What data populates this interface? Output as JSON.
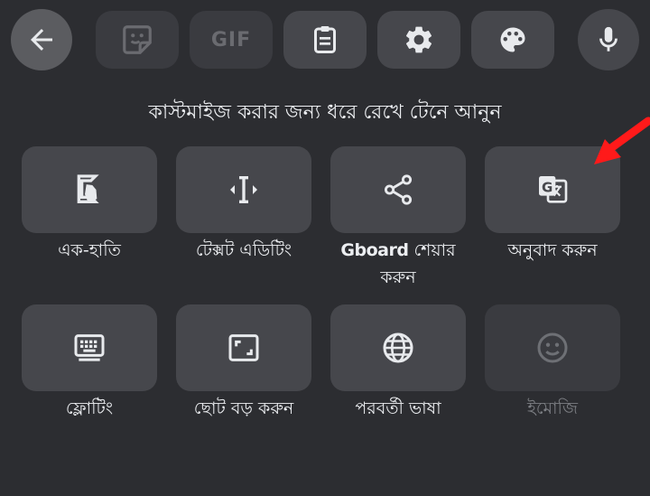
{
  "toolbar": {
    "back_icon": "arrow-left-icon",
    "sticker_icon": "sticker-icon",
    "gif_label": "GIF",
    "clipboard_icon": "clipboard-icon",
    "settings_icon": "gear-icon",
    "theme_icon": "palette-icon",
    "voice_icon": "microphone-icon"
  },
  "hint_text": "কাস্টমাইজ করার জন্য ধরে রেখে টেনে আনুন",
  "tiles": [
    {
      "label": "এক-হাতি",
      "icon": "one-handed-icon",
      "enabled": true
    },
    {
      "label": "টেক্সট এডিটিং",
      "icon": "text-cursor-icon",
      "enabled": true
    },
    {
      "brand": "Gboard",
      "label": " শেয়ার করুন",
      "icon": "share-icon",
      "enabled": true
    },
    {
      "label": "অনুবাদ করুন",
      "icon": "translate-icon",
      "enabled": true
    },
    {
      "label": "ফ্লোটিং",
      "icon": "keyboard-icon",
      "enabled": true
    },
    {
      "label": "ছোট বড় করুন",
      "icon": "resize-icon",
      "enabled": true
    },
    {
      "label": "পরবর্তী ভাষা",
      "icon": "globe-icon",
      "enabled": true
    },
    {
      "label": "ইমোজি",
      "icon": "emoji-icon",
      "enabled": false
    }
  ],
  "colors": {
    "background": "#2c2d31",
    "tile": "#46474c",
    "tile_disabled": "#3a3b40",
    "annotation_arrow": "#ff1a1a"
  }
}
